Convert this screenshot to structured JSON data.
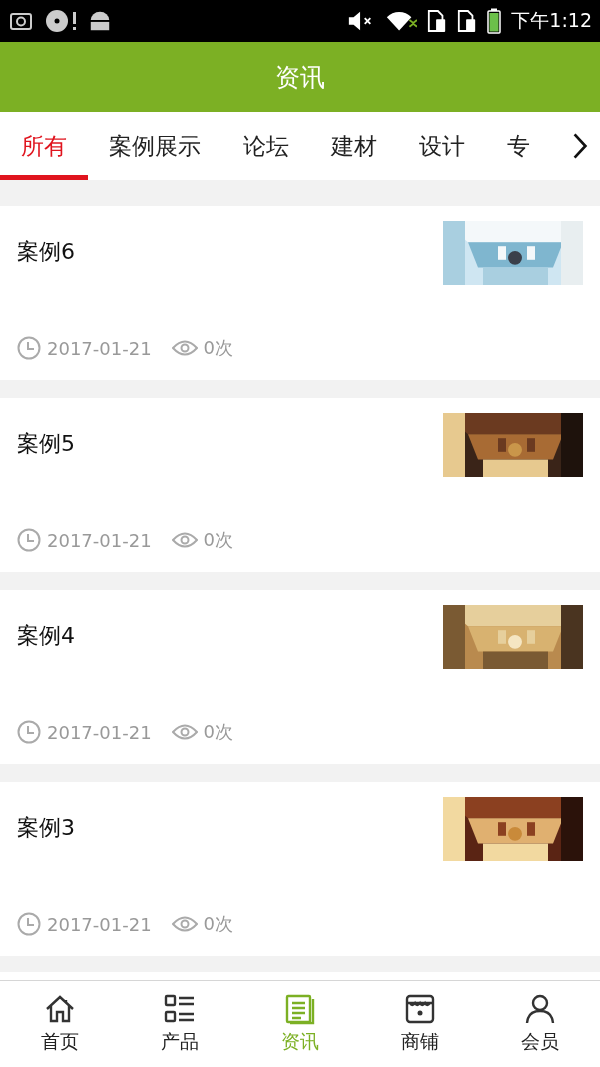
{
  "status_bar": {
    "time": "下午1:12"
  },
  "header": {
    "title": "资讯"
  },
  "tabs": [
    {
      "label": "所有",
      "selected": true
    },
    {
      "label": "案例展示",
      "selected": false
    },
    {
      "label": "论坛",
      "selected": false
    },
    {
      "label": "建材",
      "selected": false
    },
    {
      "label": "设计",
      "selected": false
    },
    {
      "label": "专",
      "selected": false
    }
  ],
  "articles": [
    {
      "title": "案例6",
      "date": "2017-01-21",
      "views": "0次"
    },
    {
      "title": "案例5",
      "date": "2017-01-21",
      "views": "0次"
    },
    {
      "title": "案例4",
      "date": "2017-01-21",
      "views": "0次"
    },
    {
      "title": "案例3",
      "date": "2017-01-21",
      "views": "0次"
    }
  ],
  "bottom_nav": [
    {
      "label": "首页",
      "kind": "home",
      "selected": false
    },
    {
      "label": "产品",
      "kind": "products",
      "selected": false
    },
    {
      "label": "资讯",
      "kind": "news",
      "selected": true
    },
    {
      "label": "商铺",
      "kind": "shop",
      "selected": false
    },
    {
      "label": "会员",
      "kind": "member",
      "selected": false
    }
  ]
}
